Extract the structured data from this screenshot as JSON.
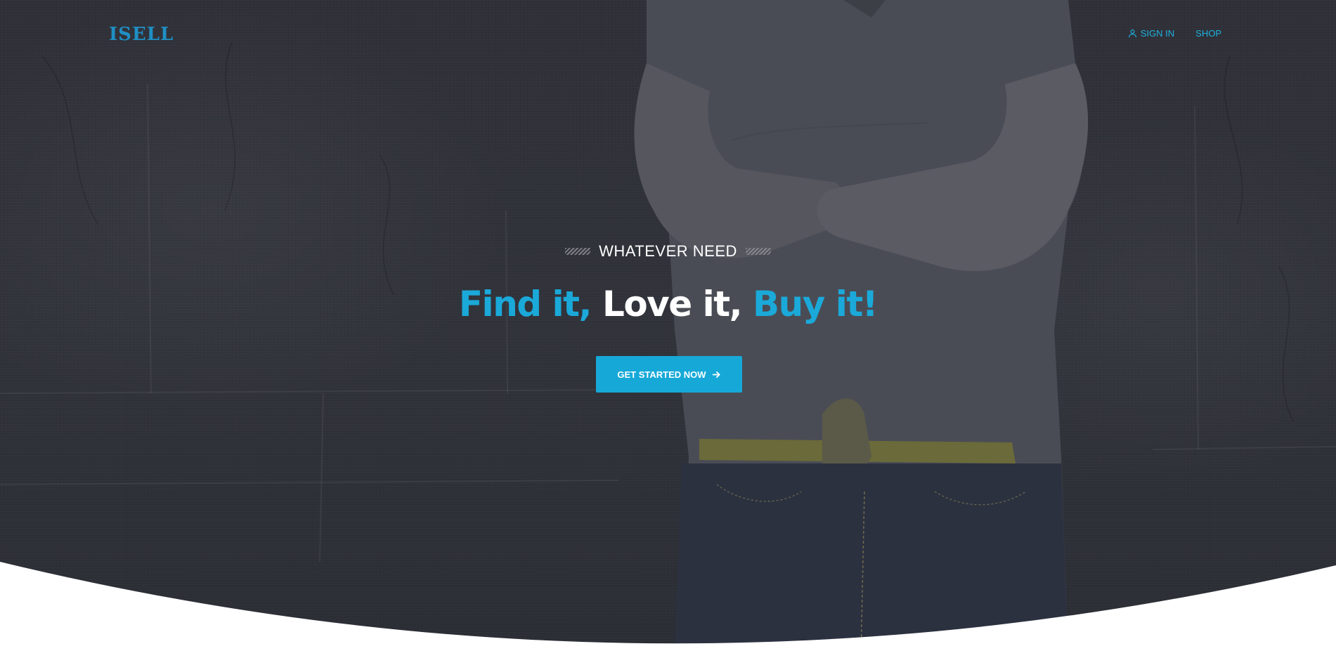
{
  "header": {
    "logo": "ISELL",
    "nav": [
      {
        "label": "SIGN IN",
        "icon": "user-icon"
      },
      {
        "label": "SHOP",
        "icon": ""
      }
    ]
  },
  "hero": {
    "eyebrow": "WHATEVER NEED",
    "headline": {
      "part1": "Find it,",
      "part2": "Love it,",
      "part3": "Buy it!"
    },
    "cta_label": "GET STARTED NOW",
    "cta_icon": "arrow-right-icon"
  },
  "colors": {
    "accent": "#16a9d8",
    "logo": "#1f8fc4",
    "hero_bg": "#30323a",
    "text_light": "#ffffff"
  }
}
